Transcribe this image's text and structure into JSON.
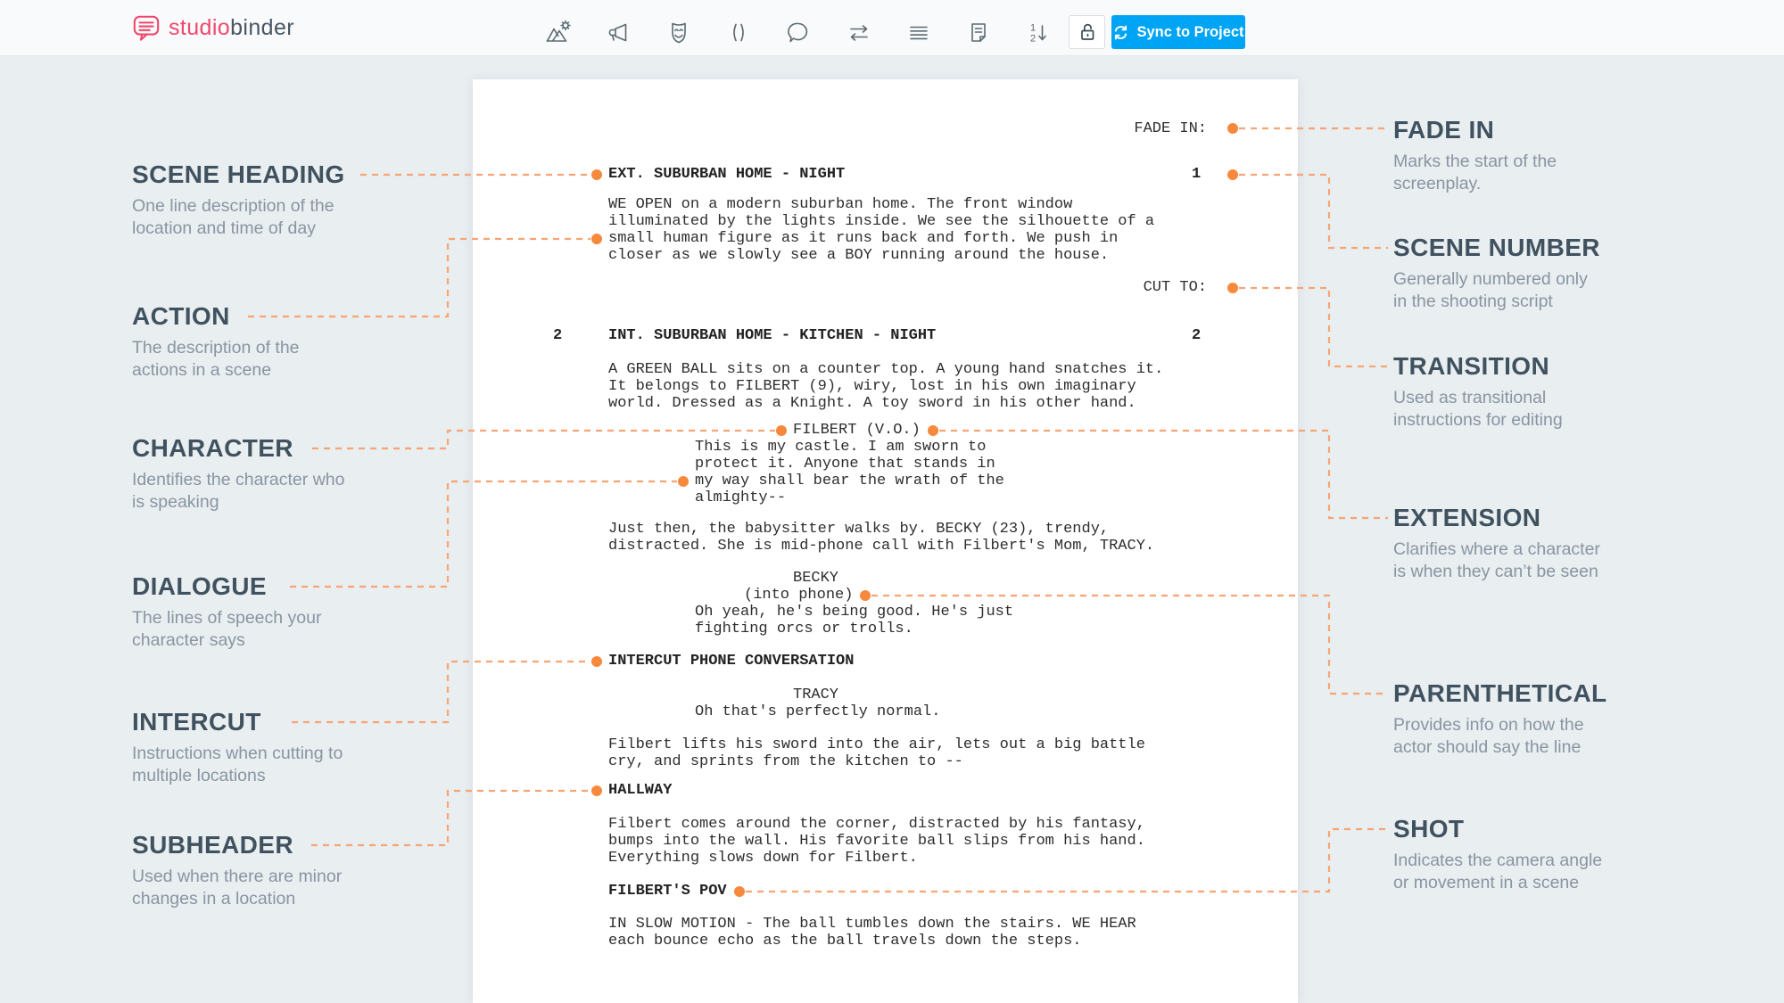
{
  "topbar": {
    "logo": {
      "studio": "studio",
      "binder": "binder"
    },
    "icons": [
      "mountain-gear",
      "megaphone",
      "theater-mask",
      "parentheses",
      "speech-bubble",
      "swap-arrows",
      "text-lines",
      "note-page",
      "numbered-sort"
    ],
    "lock": "lock-toggle",
    "sync_label": "Sync to Project"
  },
  "colors": {
    "accent_orange_dot": "#f6893c",
    "accent_orange_dash": "#f8a473",
    "brand_pink": "#ef486b",
    "sync_blue": "#00a4f4",
    "label_slate": "#40525f"
  },
  "script": {
    "fade_in": "FADE IN:",
    "cut_to": "CUT TO:",
    "scene1": {
      "heading": "EXT. SUBURBAN HOME - NIGHT",
      "number_right": "1"
    },
    "scene2": {
      "heading": "INT. SUBURBAN HOME - KITCHEN - NIGHT",
      "number_left": "2",
      "number_right": "2"
    },
    "action1": [
      "WE OPEN on a modern suburban home. The front window",
      "illuminated by the lights inside. We see the silhouette of a",
      "small human figure as it runs back and forth. We push in",
      "closer as we slowly see a BOY running around the house."
    ],
    "action2": [
      "A GREEN BALL sits on a counter top. A young hand snatches it.",
      "It belongs to FILBERT (9), wiry, lost in his own imaginary",
      "world. Dressed as a Knight. A toy sword in his other hand."
    ],
    "filbert": {
      "character": "FILBERT (V.O.)",
      "lines": [
        "This is my castle. I am sworn to",
        "protect it. Anyone that stands in",
        "my way shall bear the wrath of the",
        "almighty--"
      ]
    },
    "just_then": [
      "Just then, the babysitter walks by. BECKY (23), trendy,",
      "distracted. She is mid-phone call with Filbert's Mom, TRACY."
    ],
    "becky": {
      "character": "BECKY",
      "paren": "(into phone)",
      "lines": [
        "Oh yeah, he's being good. He's just",
        "fighting orcs or trolls."
      ]
    },
    "intercut": "INTERCUT PHONE CONVERSATION",
    "tracy": {
      "character": "TRACY",
      "lines": [
        "Oh that's perfectly normal."
      ]
    },
    "lifts": [
      "Filbert lifts his sword into the air, lets out a big battle",
      "cry, and sprints from the kitchen to --"
    ],
    "hallway": "HALLWAY",
    "comes": [
      "Filbert comes around the corner, distracted by his fantasy,",
      "bumps into the wall. His favorite ball slips from his hand.",
      "Everything slows down for Filbert."
    ],
    "pov": "FILBERT'S POV",
    "slow": [
      "IN SLOW MOTION - The ball tumbles down the stairs. WE HEAR",
      "each bounce echo as the ball travels down the steps."
    ]
  },
  "annotations": {
    "left": [
      {
        "title": "SCENE HEADING",
        "desc": [
          "One line description of the",
          "location and time of day"
        ]
      },
      {
        "title": "ACTION",
        "desc": [
          "The description of the",
          "actions in a scene"
        ]
      },
      {
        "title": "CHARACTER",
        "desc": [
          "Identifies the character who",
          "is speaking"
        ]
      },
      {
        "title": "DIALOGUE",
        "desc": [
          "The lines of speech your",
          "character says"
        ]
      },
      {
        "title": "INTERCUT",
        "desc": [
          "Instructions when cutting to",
          "multiple locations"
        ]
      },
      {
        "title": "SUBHEADER",
        "desc": [
          "Used when there are minor",
          "changes in a location"
        ]
      }
    ],
    "right": [
      {
        "title": "FADE IN",
        "desc": [
          "Marks the start of the",
          "screenplay."
        ]
      },
      {
        "title": "SCENE NUMBER",
        "desc": [
          "Generally numbered only",
          "in the shooting script"
        ]
      },
      {
        "title": "TRANSITION",
        "desc": [
          "Used as transitional",
          "instructions for editing"
        ]
      },
      {
        "title": "EXTENSION",
        "desc": [
          "Clarifies where a character",
          "is when they can’t be seen"
        ]
      },
      {
        "title": "PARENTHETICAL",
        "desc": [
          "Provides info on how the",
          "actor should say the line"
        ]
      },
      {
        "title": "SHOT",
        "desc": [
          "Indicates the camera angle",
          "or movement in a scene"
        ]
      }
    ]
  }
}
